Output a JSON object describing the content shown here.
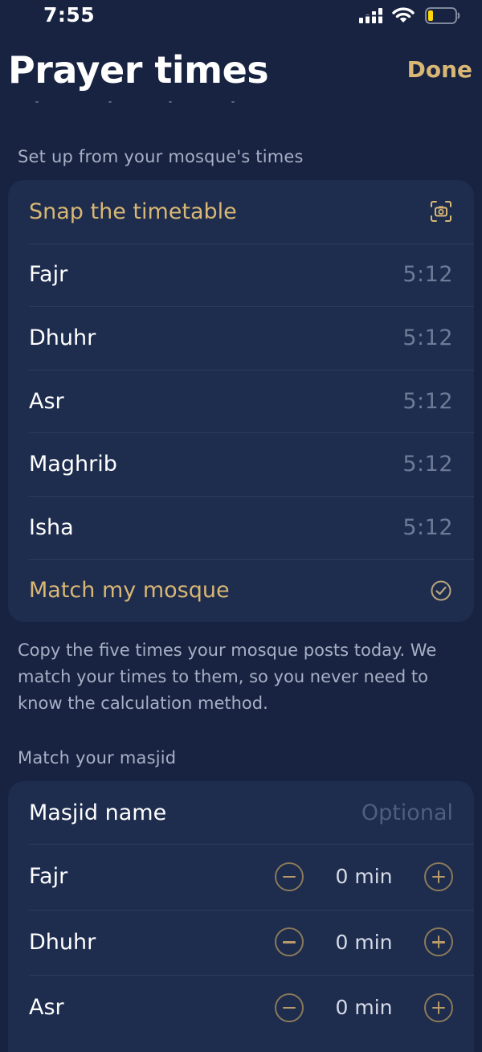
{
  "status_bar": {
    "time": "7:55"
  },
  "header": {
    "title": "Prayer times",
    "done_label": "Done"
  },
  "mosque_section": {
    "label": "Set up from your mosque's times",
    "snap_label": "Snap the timetable",
    "prayers": [
      {
        "name": "Fajr",
        "time": "5:12"
      },
      {
        "name": "Dhuhr",
        "time": "5:12"
      },
      {
        "name": "Asr",
        "time": "5:12"
      },
      {
        "name": "Maghrib",
        "time": "5:12"
      },
      {
        "name": "Isha",
        "time": "5:12"
      }
    ],
    "match_label": "Match my mosque",
    "footnote": "Copy the five times your mosque posts today. We match your times to them, so you never need to know the calculation method."
  },
  "masjid_section": {
    "label": "Match your masjid",
    "name_label": "Masjid name",
    "name_placeholder": "Optional",
    "offsets": [
      {
        "name": "Fajr",
        "value": "0 min"
      },
      {
        "name": "Dhuhr",
        "value": "0 min"
      },
      {
        "name": "Asr",
        "value": "0 min"
      }
    ]
  },
  "colors": {
    "background": "#172341",
    "card": "#1e2c4e",
    "accent_gold": "#d9b774",
    "muted_text": "#a7b0c4",
    "value_text": "#6e7a96"
  }
}
